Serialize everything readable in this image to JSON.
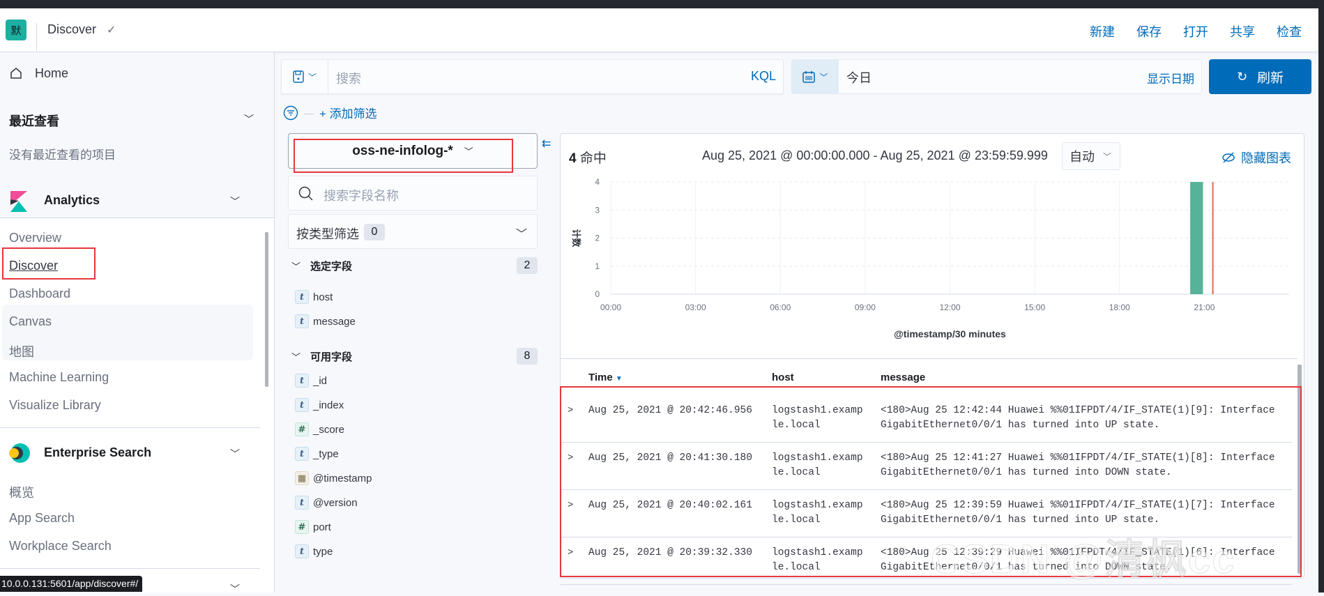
{
  "header": {
    "logo_text": "默",
    "breadcrumb": "Discover",
    "actions": [
      "新建",
      "保存",
      "打开",
      "共享",
      "检查"
    ]
  },
  "sidebar": {
    "home": "Home",
    "recent_title": "最近查看",
    "recent_empty": "没有最近查看的项目",
    "analytics": {
      "title": "Analytics",
      "items": [
        "Overview",
        "Discover",
        "Dashboard",
        "Canvas",
        "地图",
        "Machine Learning",
        "Visualize Library"
      ],
      "active": "Discover"
    },
    "enterprise": {
      "title": "Enterprise Search",
      "items": [
        "概览",
        "App Search",
        "Workplace Search"
      ]
    },
    "status_url": "10.0.0.131:5601/app/discover#/"
  },
  "query": {
    "placeholder": "搜索",
    "language": "KQL",
    "date_value": "今日",
    "show_dates": "显示日期",
    "refresh": "刷新",
    "add_filter": "+ 添加筛选"
  },
  "fields": {
    "index_pattern": "oss-ne-infolog-*",
    "search_placeholder": "搜索字段名称",
    "filter_by_type": "按类型筛选",
    "filter_count": "0",
    "selected_title": "选定字段",
    "selected_count": "2",
    "selected": [
      {
        "type": "t",
        "name": "host"
      },
      {
        "type": "t",
        "name": "message"
      }
    ],
    "available_title": "可用字段",
    "available_count": "8",
    "available": [
      {
        "type": "t",
        "name": "_id"
      },
      {
        "type": "t",
        "name": "_index"
      },
      {
        "type": "#",
        "name": "_score"
      },
      {
        "type": "t",
        "name": "_type"
      },
      {
        "type": "date",
        "name": "@timestamp"
      },
      {
        "type": "t",
        "name": "@version"
      },
      {
        "type": "#",
        "name": "port"
      },
      {
        "type": "t",
        "name": "type"
      }
    ]
  },
  "results": {
    "hits": "4",
    "hits_label": "命中",
    "range": "Aug 25, 2021 @ 00:00:00.000 - Aug 25, 2021 @ 23:59:59.999",
    "interval": "自动",
    "hide_chart": "隐藏图表",
    "columns": [
      "Time",
      "host",
      "message"
    ],
    "rows": [
      {
        "time": "Aug 25, 2021 @ 20:42:46.956",
        "host": [
          "logstash1.examp",
          "le.local"
        ],
        "message": [
          "<180>Aug 25 12:42:44 Huawei %%01IFPDT/4/IF_STATE(1)[9]: Interface",
          "GigabitEthernet0/0/1 has turned into UP state."
        ]
      },
      {
        "time": "Aug 25, 2021 @ 20:41:30.180",
        "host": [
          "logstash1.examp",
          "le.local"
        ],
        "message": [
          "<180>Aug 25 12:41:27 Huawei %%01IFPDT/4/IF_STATE(1)[8]: Interface",
          "GigabitEthernet0/0/1 has turned into DOWN state."
        ]
      },
      {
        "time": "Aug 25, 2021 @ 20:40:02.161",
        "host": [
          "logstash1.examp",
          "le.local"
        ],
        "message": [
          "<180>Aug 25 12:39:59 Huawei %%01IFPDT/4/IF_STATE(1)[7]: Interface",
          "GigabitEthernet0/0/1 has turned into UP state."
        ]
      },
      {
        "time": "Aug 25, 2021 @ 20:39:32.330",
        "host": [
          "logstash1.examp",
          "le.local"
        ],
        "message": [
          "<180>Aug 25 12:39:29 Huawei %%01IFPDT/4/IF_STATE(1)[6]: Interface",
          "GigabitEthernet0/0/1 has turned into DOWN state."
        ]
      }
    ]
  },
  "chart_data": {
    "type": "bar",
    "title": "",
    "xlabel": "@timestamp/30 minutes",
    "ylabel": "计数",
    "x_ticks": [
      "00:00",
      "03:00",
      "06:00",
      "09:00",
      "12:00",
      "15:00",
      "18:00",
      "21:00"
    ],
    "xlim_hours": [
      0,
      24
    ],
    "ylim": [
      0,
      4
    ],
    "y_ticks": [
      0,
      1,
      2,
      3,
      4
    ],
    "bucket_hours": 0.5,
    "bars": [
      {
        "start_hour": 20.5,
        "value": 4
      }
    ],
    "now_marker_hour": 21.3,
    "bar_color": "#54b399",
    "marker_color": "#e7664c",
    "grid": true
  },
  "watermark": "CSDN @清枫cc"
}
